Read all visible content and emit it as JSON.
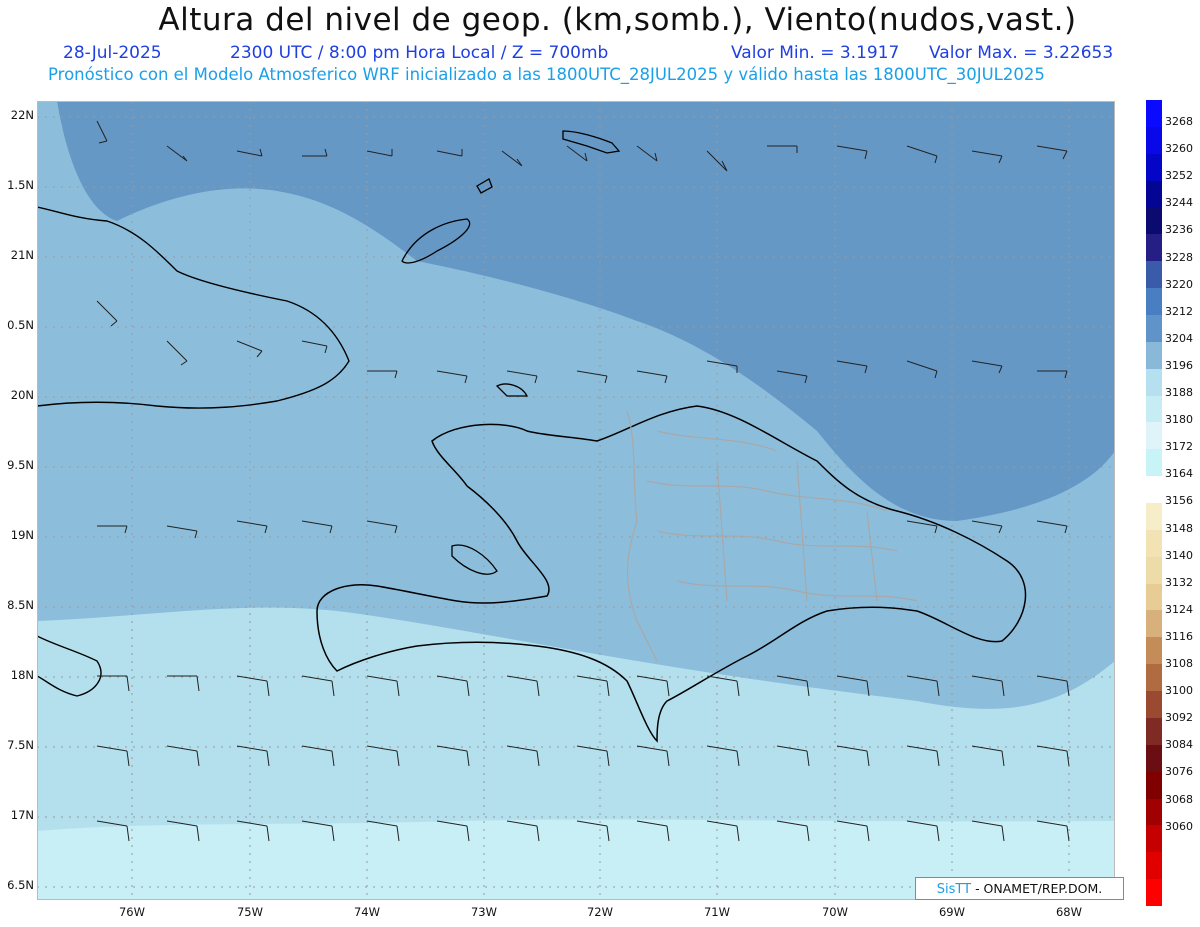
{
  "title": "Altura del nivel de geop. (km,somb.), Viento(nudos,vast.)",
  "subtitle": {
    "date": "28-Jul-2025",
    "time": "2300 UTC / 8:00 pm Hora Local / Z = 700mb",
    "min": "Valor Min. = 3.1917",
    "max": "Valor Max. = 3.22653"
  },
  "model_line": "Pronóstico con el Modelo Atmosferico WRF inicializado a las 1800UTC_28JUL2025 y válido hasta las  1800UTC_30JUL2025",
  "lat_labels": [
    "22N",
    "1.5N",
    "21N",
    "0.5N",
    "20N",
    "9.5N",
    "19N",
    "8.5N",
    "18N",
    "7.5N",
    "17N",
    "6.5N"
  ],
  "lon_labels": [
    "76W",
    "75W",
    "74W",
    "73W",
    "72W",
    "71W",
    "70W",
    "69W",
    "68W"
  ],
  "credit": {
    "brand": "SisTT",
    "org": "- ONAMET/REP.DOM."
  },
  "colorbar": {
    "labels": [
      "3268",
      "3260",
      "3252",
      "3244",
      "3236",
      "3228",
      "3220",
      "3212",
      "3204",
      "3196",
      "3188",
      "3180",
      "3172",
      "3164",
      "3156",
      "3148",
      "3140",
      "3132",
      "3124",
      "3116",
      "3108",
      "3100",
      "3092",
      "3084",
      "3076",
      "3068",
      "3060"
    ],
    "colors": [
      "#0a0aff",
      "#0808e8",
      "#0505c8",
      "#050595",
      "#0a0a70",
      "#241e85",
      "#3a5aaa",
      "#4a7ec2",
      "#6094c8",
      "#8ab8d8",
      "#b6dff0",
      "#c8ecf4",
      "#dff4f8",
      "#c8f4f8",
      "#ffffff",
      "#f6eec8",
      "#f2e2b4",
      "#eedca8",
      "#e8cc96",
      "#d8b07c",
      "#c48c58",
      "#b06c40",
      "#9a4a30",
      "#802a26",
      "#6a0e14",
      "#800000",
      "#a00000",
      "#c40000",
      "#e00000",
      "#ff0000"
    ],
    "fields": {
      "dark_band": "#6698c6",
      "mid_band": "#8cbedc",
      "light_band": "#b4e0ee",
      "pale_band": "#c8eef6"
    }
  }
}
